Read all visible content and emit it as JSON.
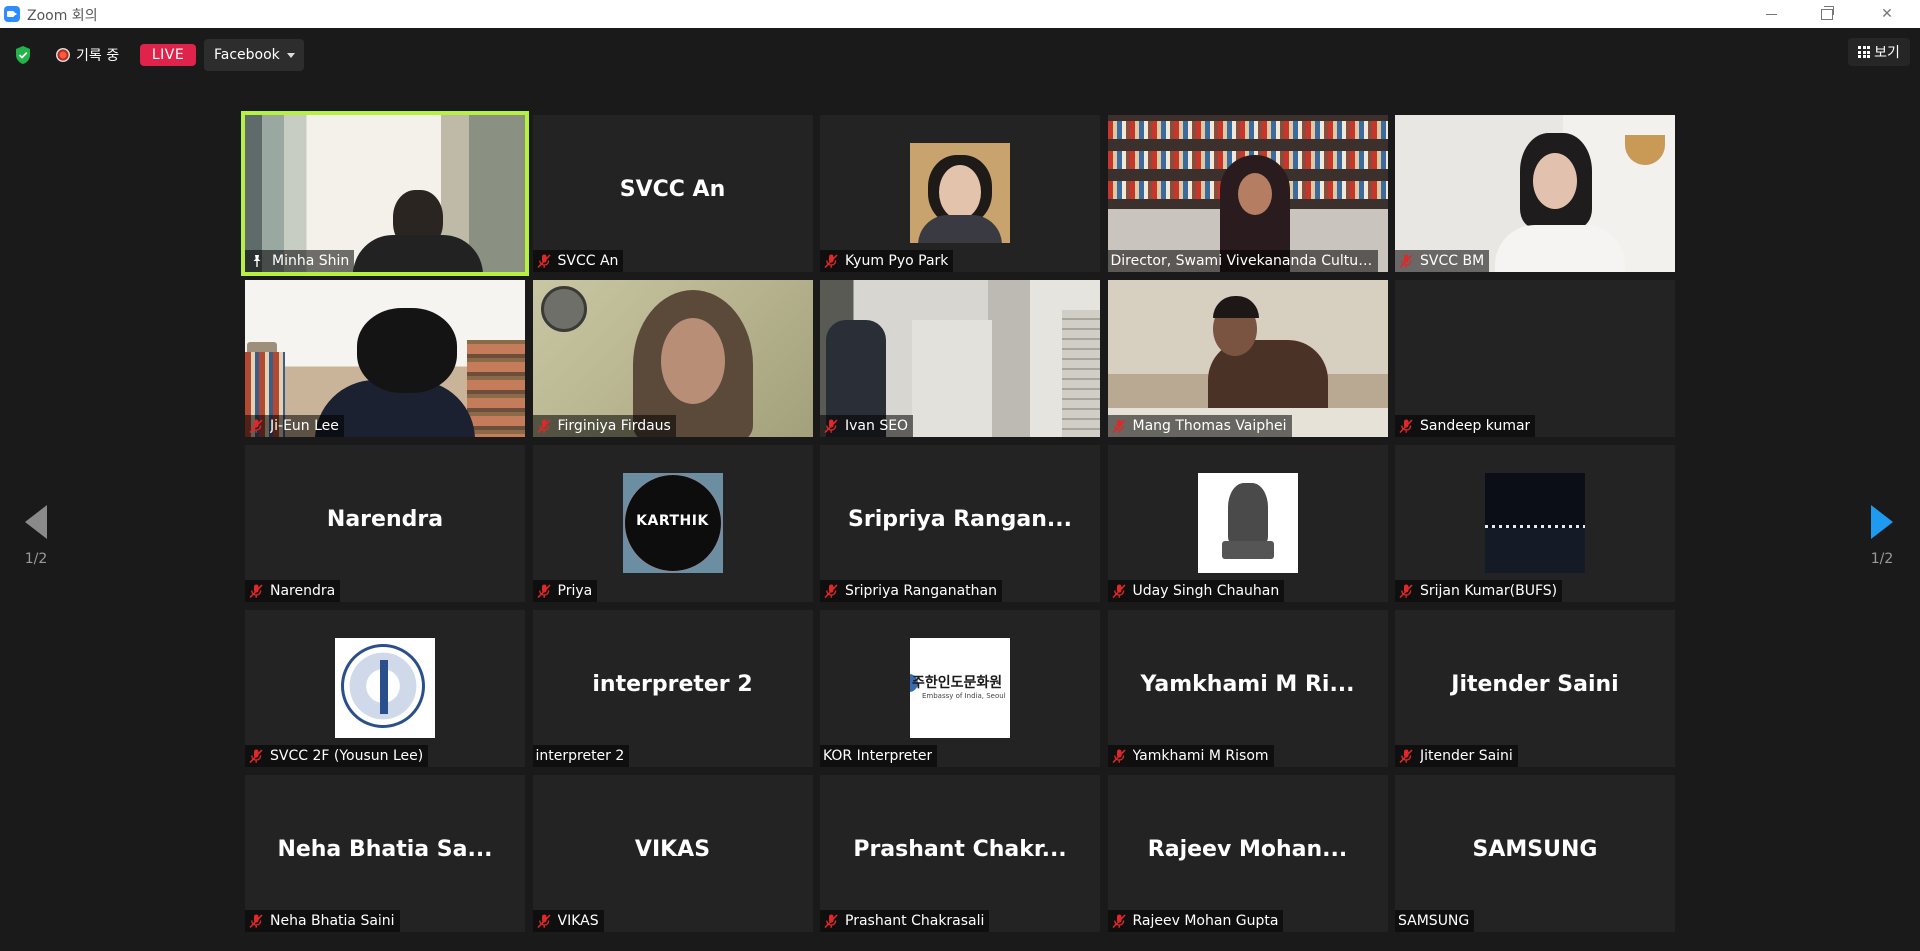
{
  "window": {
    "title": "Zoom 회의"
  },
  "toolbar": {
    "recording_label": "기록 중",
    "live_label": "LIVE",
    "stream_target": "Facebook",
    "view_label": "보기"
  },
  "pagination": {
    "current": "1/2"
  },
  "colors": {
    "active_speaker_border": "#b6f040",
    "live_badge": "#e0234a",
    "mute_icon": "#e02828",
    "next_arrow": "#1e9bf0",
    "secure_shield": "#23b34a"
  },
  "participants": [
    {
      "name": "Minha Shin",
      "display": "",
      "muted": false,
      "pinned": true,
      "active": true,
      "video": "minha"
    },
    {
      "name": "SVCC An",
      "display": "SVCC An",
      "muted": true
    },
    {
      "name": "Kyum Pyo Park",
      "display": "",
      "muted": true,
      "video": "avatar-kyum"
    },
    {
      "name": "Director, Swami Vivekananda Cultural...",
      "display": "",
      "muted": false,
      "video": "director"
    },
    {
      "name": "SVCC BM",
      "display": "",
      "muted": true,
      "video": "svccbm"
    },
    {
      "name": "Ji-Eun Lee",
      "display": "",
      "muted": true,
      "video": "jieun"
    },
    {
      "name": "Firginiya Firdaus",
      "display": "",
      "muted": true,
      "video": "firg"
    },
    {
      "name": "Ivan SEO",
      "display": "",
      "muted": true,
      "video": "ivan"
    },
    {
      "name": "Mang Thomas Vaiphei",
      "display": "",
      "muted": true,
      "video": "mang"
    },
    {
      "name": "Sandeep kumar",
      "display": "",
      "muted": true
    },
    {
      "name": "Narendra",
      "display": "Narendra",
      "muted": true
    },
    {
      "name": "Priya",
      "display": "",
      "muted": true,
      "video": "avatar-karthik",
      "avatar_text": "KARTHIK"
    },
    {
      "name": "Sripriya Ranganathan",
      "display": "Sripriya  Rangan...",
      "muted": true
    },
    {
      "name": "Uday Singh Chauhan",
      "display": "",
      "muted": true,
      "video": "avatar-emblem"
    },
    {
      "name": "Srijan Kumar(BUFS)",
      "display": "",
      "muted": true,
      "video": "avatar-bridge"
    },
    {
      "name": "SVCC 2F (Yousun Lee)",
      "display": "",
      "muted": true,
      "video": "avatar-seal"
    },
    {
      "name": "interpreter 2",
      "display": "interpreter 2",
      "muted": false
    },
    {
      "name": "KOR Interpreter",
      "display": "",
      "muted": false,
      "video": "avatar-kor",
      "avatar_text": "주한인도문화원",
      "avatar_subtext": "Embassy of India, Seoul"
    },
    {
      "name": "Yamkhami M Risom",
      "display": "Yamkhami  M  Ri...",
      "muted": true
    },
    {
      "name": "Jitender Saini",
      "display": "Jitender Saini",
      "muted": true
    },
    {
      "name": "Neha Bhatia  Saini",
      "display": "Neha  Bhatia   Sa...",
      "muted": true
    },
    {
      "name": "VIKAS",
      "display": "VIKAS",
      "muted": true
    },
    {
      "name": "Prashant Chakrasali",
      "display": "Prashant  Chakr...",
      "muted": true
    },
    {
      "name": "Rajeev Mohan Gupta",
      "display": "Rajeev  Mohan...",
      "muted": true
    },
    {
      "name": "SAMSUNG",
      "display": "SAMSUNG",
      "muted": false
    }
  ]
}
